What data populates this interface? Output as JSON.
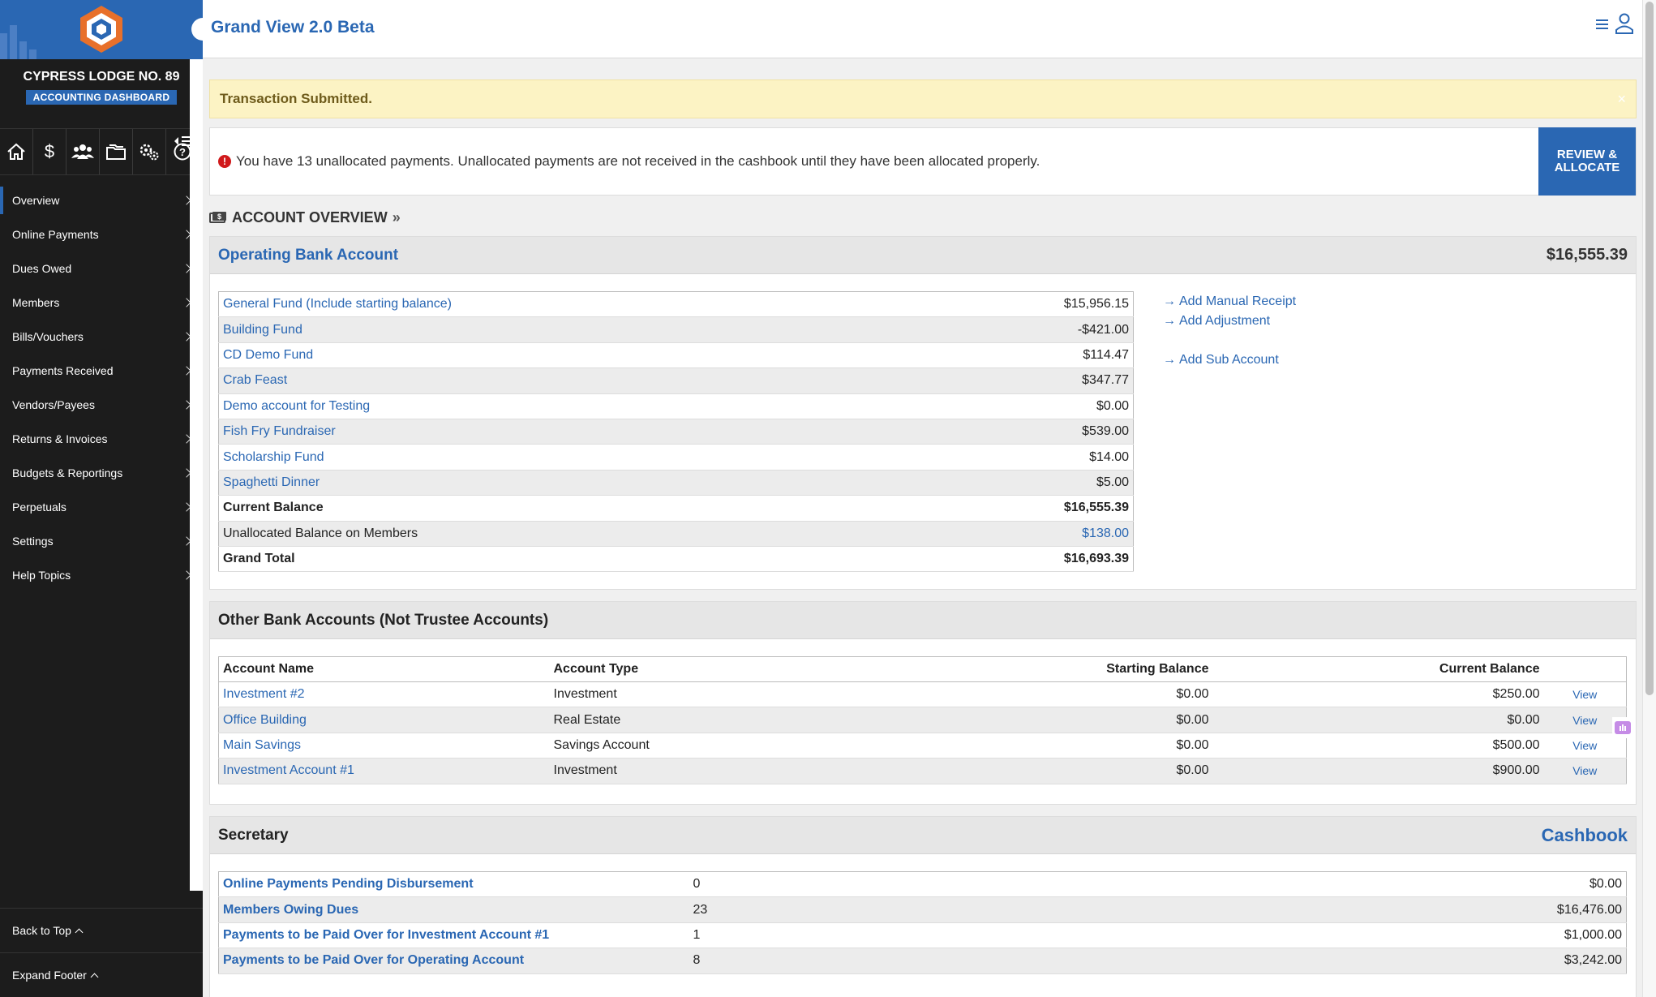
{
  "app": {
    "title": "Grand View 2.0 Beta"
  },
  "sidebar": {
    "lodge_name": "CYPRESS LODGE NO. 89",
    "badge": "ACCOUNTING DASHBOARD",
    "icons": [
      "home-icon",
      "dollar-icon",
      "members-icon",
      "folder-icon",
      "settings-gears-icon",
      "help-icon"
    ],
    "items": [
      {
        "label": "Overview"
      },
      {
        "label": "Online Payments"
      },
      {
        "label": "Dues Owed"
      },
      {
        "label": "Members"
      },
      {
        "label": "Bills/Vouchers"
      },
      {
        "label": "Payments Received"
      },
      {
        "label": "Vendors/Payees"
      },
      {
        "label": "Returns & Invoices"
      },
      {
        "label": "Budgets & Reportings"
      },
      {
        "label": "Perpetuals"
      },
      {
        "label": "Settings"
      },
      {
        "label": "Help Topics"
      }
    ],
    "footer": {
      "back_to_top": "Back to Top",
      "expand_footer": "Expand Footer"
    }
  },
  "alert": {
    "message": "Transaction Submitted.",
    "close": "×"
  },
  "notice": {
    "text": "You have 13 unallocated payments. Unallocated payments are not received in the cashbook until they have been allocated properly.",
    "icon": "!",
    "button": "REVIEW & ALLOCATE"
  },
  "overview": {
    "heading": "ACCOUNT OVERVIEW",
    "arrow": "»"
  },
  "operating": {
    "title": "Operating Bank Account",
    "amount": "$16,555.39",
    "funds": [
      {
        "name": "General Fund (Include starting balance)",
        "value": "$15,956.15"
      },
      {
        "name": "Building Fund",
        "value": "-$421.00"
      },
      {
        "name": "CD Demo Fund",
        "value": "$114.47"
      },
      {
        "name": "Crab Feast",
        "value": "$347.77"
      },
      {
        "name": "Demo account for Testing",
        "value": "$0.00"
      },
      {
        "name": "Fish Fry Fundraiser",
        "value": "$539.00"
      },
      {
        "name": "Scholarship Fund",
        "value": "$14.00"
      },
      {
        "name": "Spaghetti Dinner",
        "value": "$5.00"
      }
    ],
    "current_balance": {
      "label": "Current Balance",
      "value": "$16,555.39"
    },
    "unallocated": {
      "label": "Unallocated Balance on Members",
      "value": "$138.00"
    },
    "grand_total": {
      "label": "Grand Total",
      "value": "$16,693.39"
    },
    "links": {
      "add_manual_receipt": "Add Manual Receipt",
      "add_adjustment": "Add Adjustment",
      "add_sub_account": "Add Sub Account"
    }
  },
  "other_accounts": {
    "title": "Other Bank Accounts (Not Trustee Accounts)",
    "columns": [
      "Account Name",
      "Account Type",
      "Starting Balance",
      "Current Balance"
    ],
    "view_label": "View",
    "rows": [
      {
        "name": "Investment #2",
        "type": "Investment",
        "starting": "$0.00",
        "current": "$250.00"
      },
      {
        "name": "Office Building",
        "type": "Real Estate",
        "starting": "$0.00",
        "current": "$0.00"
      },
      {
        "name": "Main Savings",
        "type": "Savings Account",
        "starting": "$0.00",
        "current": "$500.00"
      },
      {
        "name": "Investment Account #1",
        "type": "Investment",
        "starting": "$0.00",
        "current": "$900.00"
      }
    ]
  },
  "secretary": {
    "title": "Secretary",
    "cashbook": "Cashbook",
    "rows": [
      {
        "label": "Online Payments Pending Disbursement",
        "count": "0",
        "amount": "$0.00"
      },
      {
        "label": "Members Owing Dues",
        "count": "23",
        "amount": "$16,476.00"
      },
      {
        "label": "Payments to be Paid Over for Investment Account #1",
        "count": "1",
        "amount": "$1,000.00"
      },
      {
        "label": "Payments to be Paid Over for Operating Account",
        "count": "8",
        "amount": "$3,242.00"
      }
    ]
  },
  "colors": {
    "brand_blue": "#2a67b3",
    "logo_orange": "#e8702a",
    "alert_bg": "#fcf3c4",
    "error_red": "#d0191b"
  }
}
